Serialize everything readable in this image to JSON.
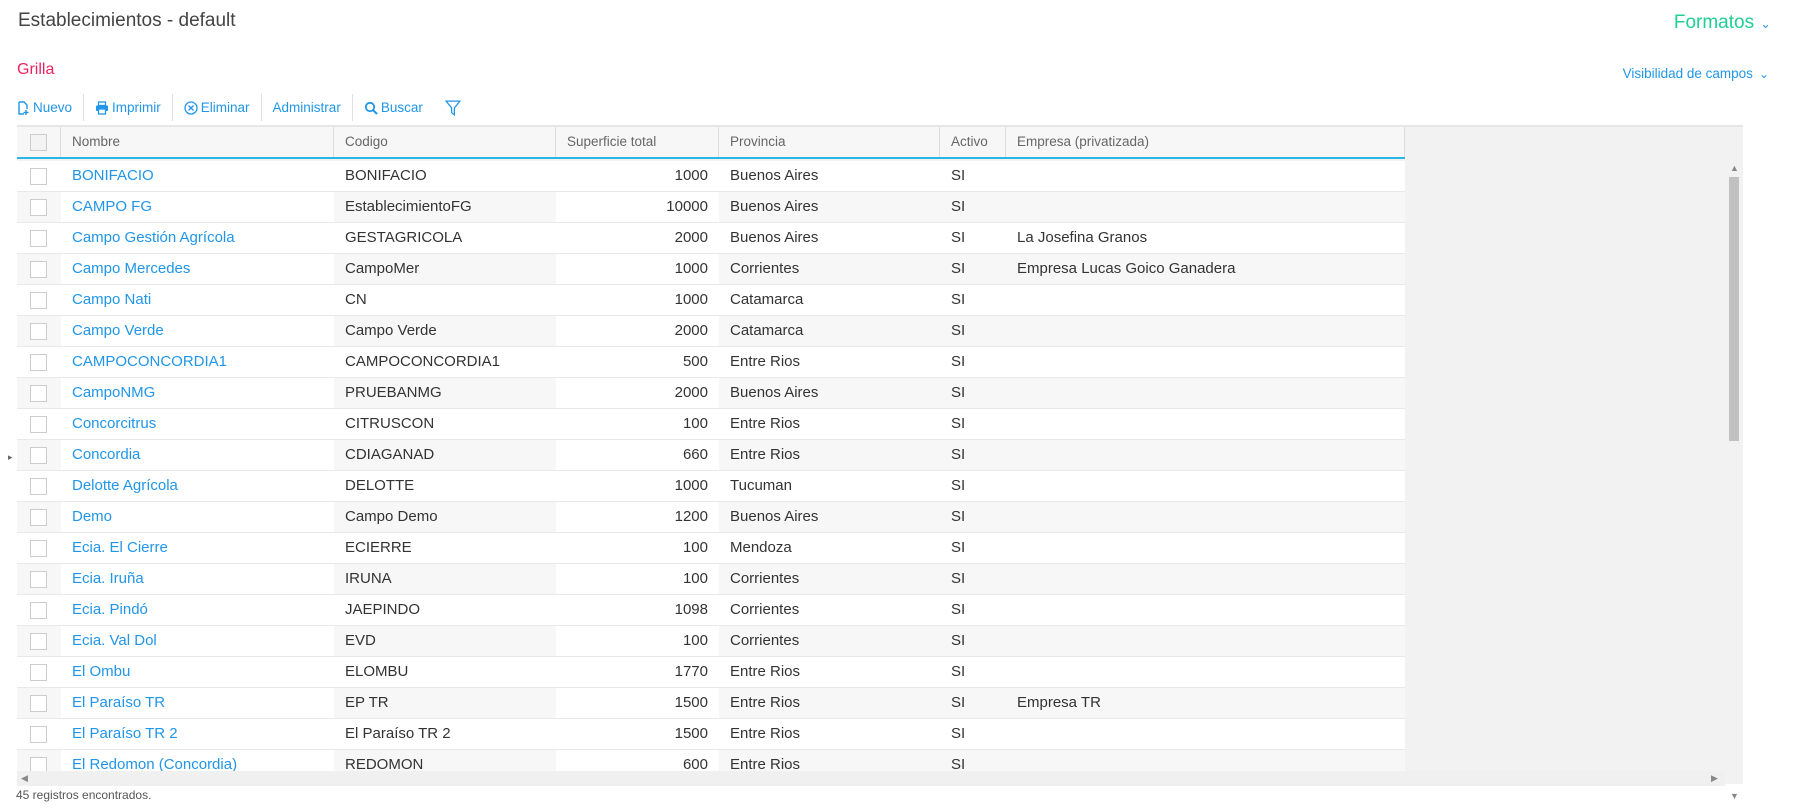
{
  "header": {
    "title": "Establecimientos - default",
    "formatos": "Formatos"
  },
  "section": {
    "title": "Grilla",
    "visibility": "Visibilidad de campos"
  },
  "toolbar": {
    "nuevo": "Nuevo",
    "imprimir": "Imprimir",
    "eliminar": "Eliminar",
    "administrar": "Administrar",
    "buscar": "Buscar"
  },
  "colors": {
    "accent": "#2196e8",
    "formatos": "#1fcf92",
    "section": "#e8245f"
  },
  "columns": [
    "Nombre",
    "Codigo",
    "Superficie total",
    "Provincia",
    "Activo",
    "Empresa (privatizada)"
  ],
  "rows": [
    [
      "BONIFACIO",
      "BONIFACIO",
      "1000",
      "Buenos Aires",
      "SI",
      ""
    ],
    [
      "CAMPO FG",
      "EstablecimientoFG",
      "10000",
      "Buenos Aires",
      "SI",
      ""
    ],
    [
      "Campo Gestión Agrícola",
      "GESTAGRICOLA",
      "2000",
      "Buenos Aires",
      "SI",
      "La Josefina Granos"
    ],
    [
      "Campo Mercedes",
      "CampoMer",
      "1000",
      "Corrientes",
      "SI",
      "Empresa Lucas Goico Ganadera"
    ],
    [
      "Campo Nati",
      "CN",
      "1000",
      "Catamarca",
      "SI",
      ""
    ],
    [
      "Campo Verde",
      "Campo Verde",
      "2000",
      "Catamarca",
      "SI",
      ""
    ],
    [
      "CAMPOCONCORDIA1",
      "CAMPOCONCORDIA1",
      "500",
      "Entre Rios",
      "SI",
      ""
    ],
    [
      "CampoNMG",
      "PRUEBANMG",
      "2000",
      "Buenos Aires",
      "SI",
      ""
    ],
    [
      "Concorcitrus",
      "CITRUSCON",
      "100",
      "Entre Rios",
      "SI",
      ""
    ],
    [
      "Concordia",
      "CDIAGANAD",
      "660",
      "Entre Rios",
      "SI",
      ""
    ],
    [
      "Delotte Agrícola",
      "DELOTTE",
      "1000",
      "Tucuman",
      "SI",
      ""
    ],
    [
      "Demo",
      "Campo Demo",
      "1200",
      "Buenos Aires",
      "SI",
      ""
    ],
    [
      "Ecia. El Cierre",
      "ECIERRE",
      "100",
      "Mendoza",
      "SI",
      ""
    ],
    [
      "Ecia. Iruña",
      "IRUNA",
      "100",
      "Corrientes",
      "SI",
      ""
    ],
    [
      "Ecia. Pindó",
      "JAEPINDO",
      "1098",
      "Corrientes",
      "SI",
      ""
    ],
    [
      "Ecia. Val Dol",
      "EVD",
      "100",
      "Corrientes",
      "SI",
      ""
    ],
    [
      "El Ombu",
      "ELOMBU",
      "1770",
      "Entre Rios",
      "SI",
      ""
    ],
    [
      "El Paraíso TR",
      "EP TR",
      "1500",
      "Entre Rios",
      "SI",
      "Empresa TR"
    ],
    [
      "El Paraíso TR 2",
      "El Paraíso TR 2",
      "1500",
      "Entre Rios",
      "SI",
      ""
    ],
    [
      "El Redomon (Concordia)",
      "REDOMON",
      "600",
      "Entre Rios",
      "SI",
      ""
    ]
  ],
  "footer": "45 registros encontrados."
}
